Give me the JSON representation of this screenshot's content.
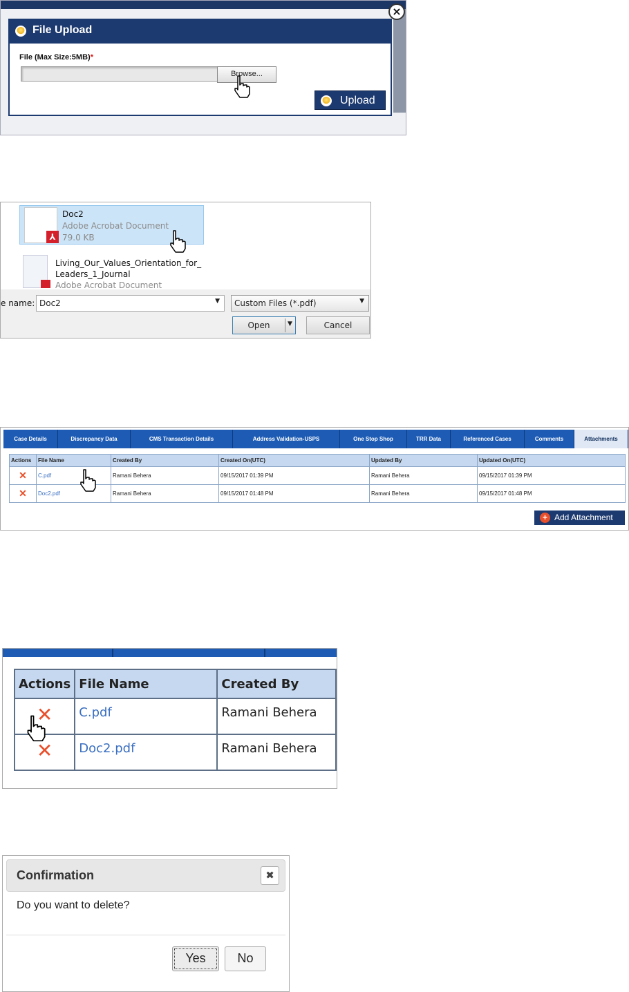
{
  "file_upload": {
    "title": "File Upload",
    "file_label": "File (Max Size:5MB)",
    "required_mark": "*",
    "file_value": "",
    "browse_label": "Browse...",
    "upload_label": "Upload",
    "close_symbol": "×",
    "icons": [
      "close-icon",
      "upload-coin-icon",
      "hand-cursor-icon"
    ]
  },
  "open_dialog": {
    "selected_file": {
      "name": "Doc2",
      "type": "Adobe Acrobat Document",
      "size": "79.0 KB"
    },
    "other_file": {
      "name_line1": "Living_Our_Values_Orientation_for_",
      "name_line2": "Leaders_1_Journal",
      "type": "Adobe Acrobat Document"
    },
    "file_name_label": "e name:",
    "file_name_value": "Doc2",
    "filter_value": "Custom Files (*.pdf)",
    "open_label": "Open",
    "cancel_label": "Cancel"
  },
  "case_tabs": {
    "tabs": [
      "Case Details",
      "Discrepancy Data",
      "CMS Transaction Details",
      "Address Validation-USPS",
      "One Stop Shop",
      "TRR Data",
      "Referenced Cases",
      "Comments",
      "Attachments"
    ],
    "active_tab": "Attachments",
    "columns": [
      "Actions",
      "File Name",
      "Created By",
      "Created On(UTC)",
      "Updated By",
      "Updated On(UTC)"
    ],
    "rows": [
      {
        "action": "✕",
        "file_name": "C.pdf",
        "created_by": "Ramani Behera",
        "created_on": "09/15/2017 01:39 PM",
        "updated_by": "Ramani Behera",
        "updated_on": "09/15/2017 01:39 PM"
      },
      {
        "action": "✕",
        "file_name": "Doc2.pdf",
        "created_by": "Ramani Behera",
        "created_on": "09/15/2017 01:48 PM",
        "updated_by": "Ramani Behera",
        "updated_on": "09/15/2017 01:48 PM"
      }
    ],
    "add_attachment_label": "Add Attachment",
    "add_symbol": "+"
  },
  "zoomed_grid": {
    "columns": [
      "Actions",
      "File Name",
      "Created By"
    ],
    "rows": [
      {
        "action": "✕",
        "file_name": "C.pdf",
        "created_by": "Ramani Behera"
      },
      {
        "action": "✕",
        "file_name": "Doc2.pdf",
        "created_by": "Ramani Behera"
      }
    ]
  },
  "confirmation": {
    "title": "Confirmation",
    "close_symbol": "✖",
    "message": "Do you want to delete?",
    "yes_label": "Yes",
    "no_label": "No"
  },
  "colors": {
    "navy": "#1d3a70",
    "tab_blue": "#1d5bb4",
    "delete_red": "#e8502c",
    "link_blue": "#3a6fc1",
    "pdf_red": "#d4202a"
  }
}
